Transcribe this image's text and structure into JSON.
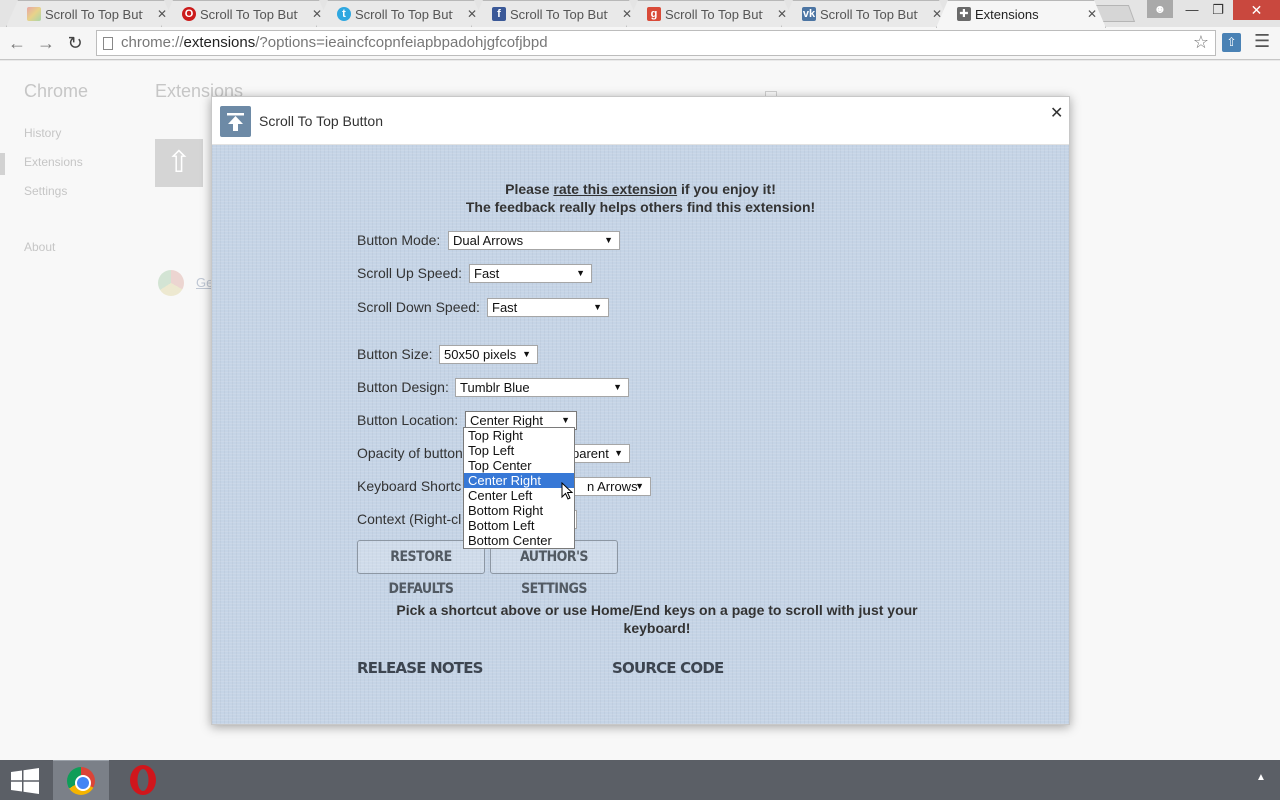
{
  "tabs": [
    {
      "label": "Scroll To Top Butto",
      "icon": "rainbow-page-icon",
      "color": "#d9a441"
    },
    {
      "label": "Scroll To Top Butto",
      "icon": "opera-icon",
      "color": "#cc1b1b"
    },
    {
      "label": "Scroll To Top Butto",
      "icon": "twitter-icon",
      "color": "#2ea7e0"
    },
    {
      "label": "Scroll To Top Butto",
      "icon": "facebook-icon",
      "color": "#3b5998"
    },
    {
      "label": "Scroll To Top Butto",
      "icon": "google-plus-icon",
      "color": "#d94a38"
    },
    {
      "label": "Scroll To Top Butto",
      "icon": "vk-icon",
      "color": "#4c75a3"
    },
    {
      "label": "Extensions",
      "icon": "puzzle-icon",
      "color": "#555555",
      "active": true
    }
  ],
  "address": {
    "scheme": "chrome://",
    "host": "extensions",
    "rest": "/?options=ieaincfcopnfeiapbpadohjgfcofjbpd"
  },
  "background_page": {
    "app_title": "Chrome",
    "nav": [
      "History",
      "Extensions",
      "Settings",
      "About"
    ],
    "page_title": "Extensions",
    "gallery_link": "Ge"
  },
  "dialog": {
    "title": "Scroll To Top Button",
    "rate_prefix": "Please ",
    "rate_link": "rate this extension",
    "rate_suffix": " if you enjoy it!",
    "feedback_line": "The feedback really helps others find this extension!",
    "options": {
      "button_mode": {
        "label": "Button Mode:",
        "value": "Dual Arrows"
      },
      "scroll_up_speed": {
        "label": "Scroll Up Speed:",
        "value": "Fast"
      },
      "scroll_down_speed": {
        "label": "Scroll Down Speed:",
        "value": "Fast"
      },
      "button_size": {
        "label": "Button Size:",
        "value": "50x50 pixels"
      },
      "button_design": {
        "label": "Button Design:",
        "value": "Tumblr Blue"
      },
      "button_location": {
        "label": "Button Location:",
        "value": "Center Right"
      },
      "opacity": {
        "label": "Opacity of button",
        "value": "parent"
      },
      "keyboard_shortcut": {
        "label": "Keyboard Shortc",
        "value": "n Arrows"
      },
      "context_menu": {
        "label": "Context (Right-cl"
      }
    },
    "location_options": [
      "Top Right",
      "Top Left",
      "Top Center",
      "Center Right",
      "Center Left",
      "Bottom Right",
      "Bottom Left",
      "Bottom Center"
    ],
    "location_selected": "Center Right",
    "buttons": {
      "restore": "RESTORE DEFAULTS",
      "author": "AUTHOR'S SETTINGS"
    },
    "hint": "Pick a shortcut above or use Home/End keys on a page to scroll with just your keyboard!",
    "links": {
      "release_notes": "RELEASE NOTES",
      "source_code": "SOURCE CODE"
    }
  },
  "colors": {
    "dialog_background": "#c5d4e6",
    "selected_item": "#3778d6",
    "close_button": "#c9483e"
  }
}
